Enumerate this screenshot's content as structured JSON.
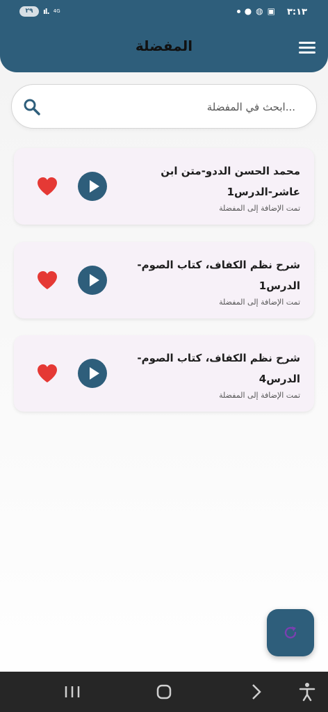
{
  "status_bar": {
    "time": "٣:١٣",
    "battery": "٢٩",
    "network": "4G"
  },
  "header": {
    "title": "المفضلة"
  },
  "search": {
    "placeholder": "...ابحث في المفضلة"
  },
  "favorites": [
    {
      "title": "محمد الحسن الددو-متن ابن عاشر-الدرس1",
      "subtitle": "تمت الإضافة إلى المفضلة"
    },
    {
      "title": "شرح نظم الكفاف، كتاب الصوم-الدرس1",
      "subtitle": "تمت الإضافة إلى المفضلة"
    },
    {
      "title": "شرح نظم الكفاف، كتاب الصوم-الدرس4",
      "subtitle": "تمت الإضافة إلى المفضلة"
    }
  ],
  "colors": {
    "primary": "#2e5e7b",
    "card": "#f7f1f8",
    "heart": "#e53935"
  },
  "icons": [
    "menu-icon",
    "search-icon",
    "play-icon",
    "heart-icon",
    "refresh-icon",
    "recent-apps-icon",
    "home-icon",
    "back-icon",
    "accessibility-icon"
  ]
}
